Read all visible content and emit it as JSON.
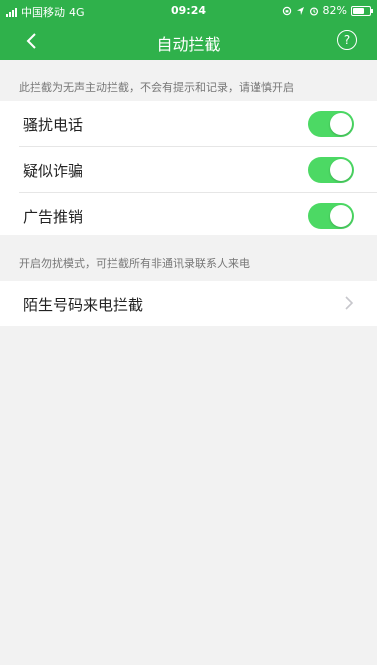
{
  "status": {
    "carrier": "中国移动",
    "network": "4G",
    "time": "09:24",
    "battery": "82%",
    "battery_level": 0.82
  },
  "nav": {
    "title": "自动拦截",
    "help_label": "?"
  },
  "intercept_hint": "此拦截为无声主动拦截，不会有提示和记录，请谨慎开启",
  "toggles": [
    {
      "label": "骚扰电话",
      "enabled": true
    },
    {
      "label": "疑似诈骗",
      "enabled": true
    },
    {
      "label": "广告推销",
      "enabled": true
    }
  ],
  "dnd_hint": "开启勿扰模式，可拦截所有非通讯录联系人来电",
  "stranger": {
    "label": "陌生号码来电拦截"
  },
  "colors": {
    "brand_green": "#2fb14b",
    "switch_on": "#4cd964",
    "background": "#f2f2f2"
  }
}
